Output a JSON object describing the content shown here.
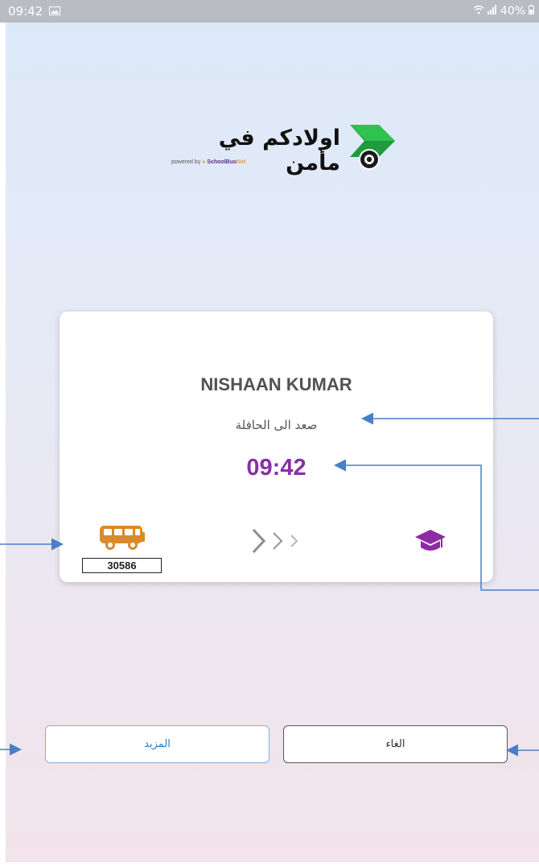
{
  "status_bar": {
    "time": "09:42",
    "battery": "40%"
  },
  "logo": {
    "title": "اولادكم في مأمن",
    "powered_by": "powered by",
    "brand_main": "SchoolBus",
    "brand_suffix": "Net"
  },
  "card": {
    "student_name": "NISHAAN KUMAR",
    "status": "صعد الى الحافلة",
    "time": "09:42",
    "bus_number": "30586"
  },
  "buttons": {
    "more": "المزيد",
    "cancel": "الغاء"
  },
  "colors": {
    "bus": "#d98a2a",
    "school": "#8e2ba3",
    "time": "#8b2fa8",
    "annotation_arrow": "#4a7ec9"
  },
  "icons": [
    "bus-icon",
    "graduation-cap-icon",
    "chevrons-right-icon",
    "wifi-icon",
    "signal-icon",
    "battery-icon",
    "gallery-icon"
  ]
}
